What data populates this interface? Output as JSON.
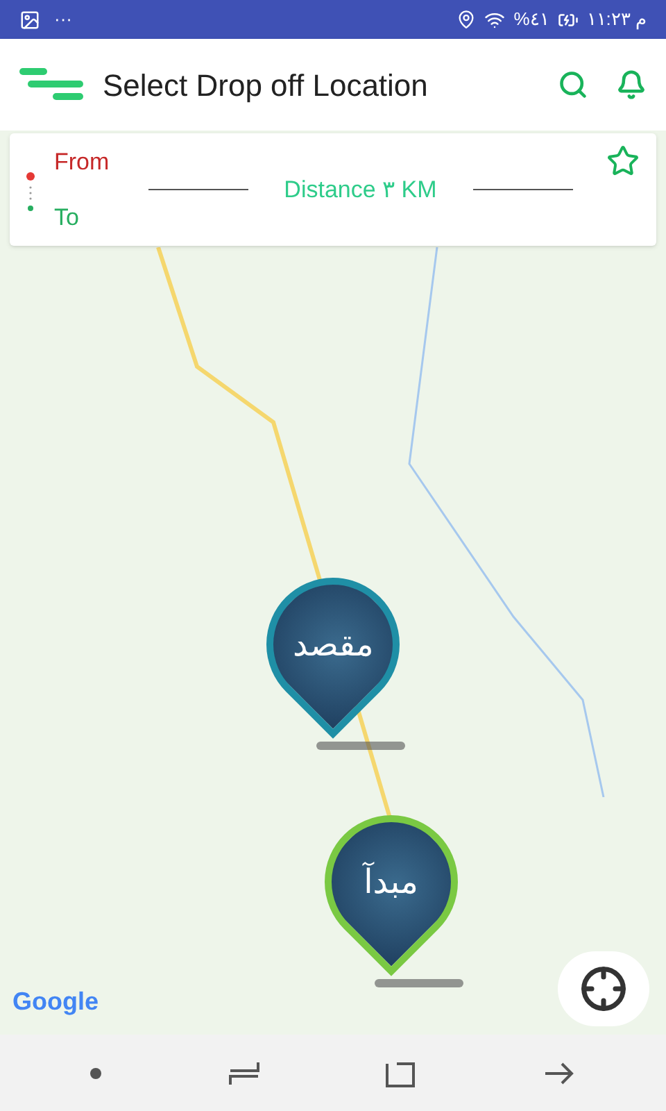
{
  "status_bar": {
    "time": "۱۱:۲۳ م",
    "battery": "%٤١",
    "more": "···"
  },
  "app_bar": {
    "title": "Select Drop off Location"
  },
  "route_card": {
    "from_label": "From",
    "to_label": "To",
    "distance": "Distance ۳ KM",
    "favorite": false
  },
  "map": {
    "markers": [
      {
        "kind": "destination",
        "label": "مقصد"
      },
      {
        "kind": "origin",
        "label": "مبدآ"
      }
    ],
    "attribution": "Google"
  }
}
